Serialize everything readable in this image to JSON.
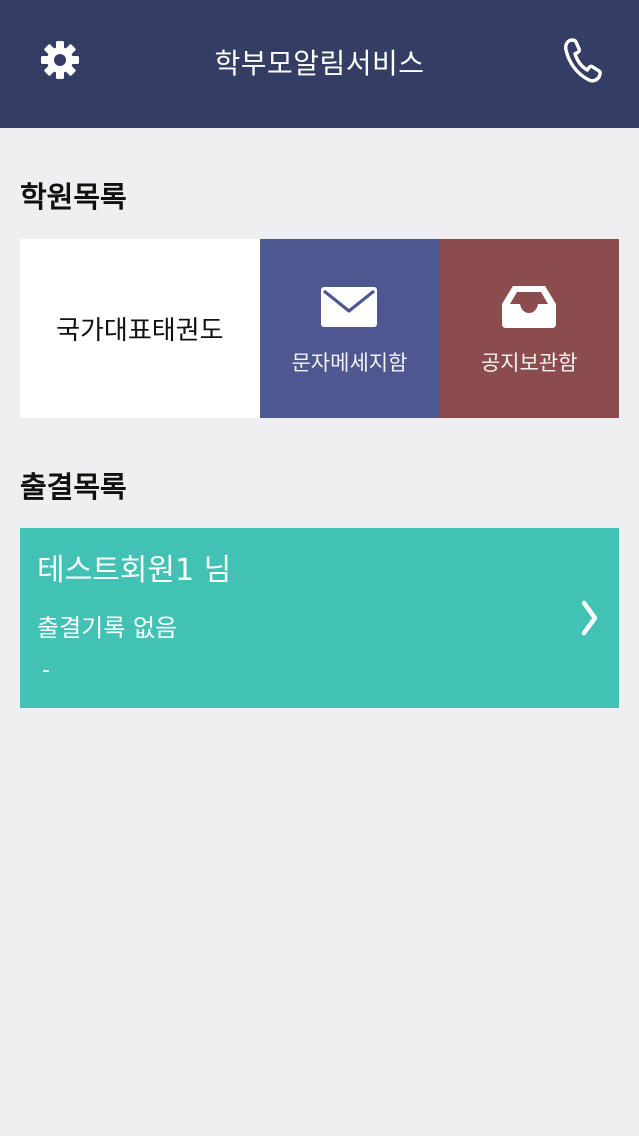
{
  "header": {
    "title": "학부모알림서비스",
    "left_icon": "gear-icon",
    "right_icon": "phone-icon",
    "background": "#343e64"
  },
  "academy_section": {
    "title": "학원목록",
    "academy_name": "국가대표태권도",
    "sms_tile": {
      "label": "문자메세지함",
      "icon": "envelope-icon",
      "color": "#4e5790"
    },
    "notice_tile": {
      "label": "공지보관함",
      "icon": "inbox-tray-icon",
      "color": "#8b4c4e"
    }
  },
  "attendance_section": {
    "title": "출결목록",
    "card": {
      "member_name": "테스트회원1 님",
      "record_status": "출결기록 없음",
      "record_detail": "-",
      "color": "#41c2b5",
      "arrow_icon": "chevron-right-icon"
    }
  }
}
